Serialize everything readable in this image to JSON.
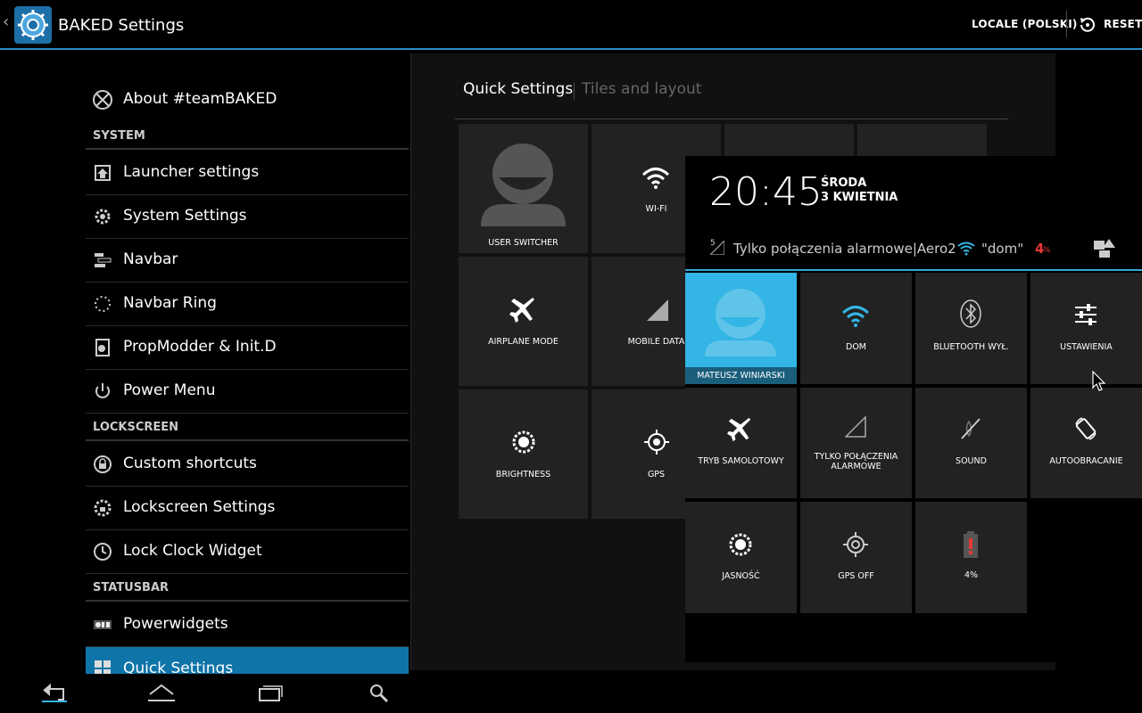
{
  "app": {
    "title": "BAKED Settings"
  },
  "actionbar": {
    "locale_label": "LOCALE (POLSKI)",
    "reset_label": "RESET"
  },
  "sidebar": {
    "about": "About #teamBAKED",
    "sections": [
      {
        "header": "SYSTEM",
        "items": [
          "Launcher settings",
          "System Settings",
          "Navbar",
          "Navbar Ring",
          "PropModder & Init.D",
          "Power Menu"
        ]
      },
      {
        "header": "LOCKSCREEN",
        "items": [
          "Custom shortcuts",
          "Lockscreen Settings",
          "Lock Clock Widget"
        ]
      },
      {
        "header": "STATUSBAR",
        "items": [
          "Powerwidgets",
          "Quick Settings"
        ]
      }
    ],
    "selected": "Quick Settings"
  },
  "tabs": {
    "active": "Quick Settings",
    "inactive": "Tiles and layout"
  },
  "preview_tiles": [
    "USER SWITCHER",
    "WI-FI",
    "AIRPLANE MODE",
    "MOBILE DATA",
    "BRIGHTNESS",
    "GPS"
  ],
  "shade": {
    "time": "20:45",
    "day": "ŚRODA",
    "date": "3 KWIETNIA",
    "carrier": "Tylko połączenia alarmowe|Aero2",
    "wifi_name": "\"dom\"",
    "battery": "4",
    "battery_unit": "%",
    "signal_small": "5",
    "tiles": [
      "MATEUSZ WINIARSKI",
      "DOM",
      "BLUETOOTH WYŁ.",
      "USTAWIENIA",
      "TRYB SAMOLOTOWY",
      "TYLKO POŁĄCZENIA ALARMOWE",
      "SOUND",
      "AUTOOBRACANIE",
      "JASNOŚĆ",
      "GPS OFF",
      "4%"
    ]
  },
  "colors": {
    "accent": "#33b5e5",
    "selected_row": "#0f74a8",
    "battery_low": "#e53935"
  }
}
